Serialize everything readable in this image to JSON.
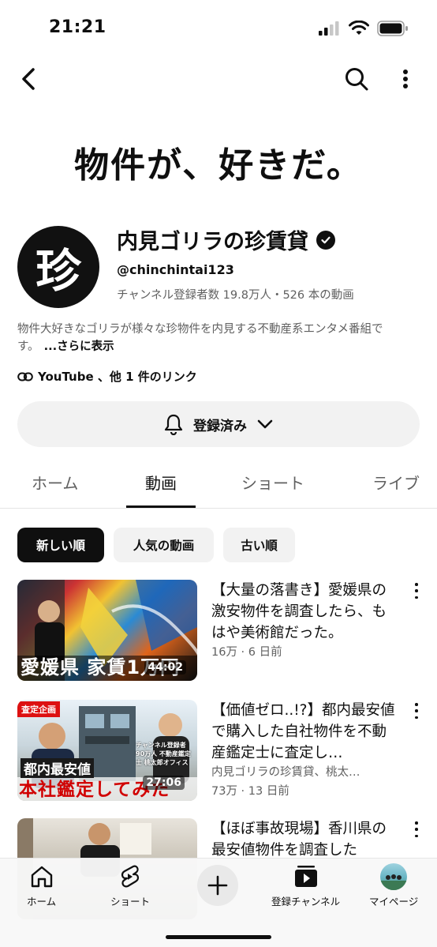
{
  "status_bar": {
    "time": "21:21"
  },
  "channel": {
    "banner_text": "物件が、好きだ。",
    "avatar_char": "珍",
    "name": "内見ゴリラの珍賃貸",
    "handle": "@chinchintai123",
    "stats": "チャンネル登録者数 19.8万人・526 本の動画",
    "description": "物件大好きなゴリラが様々な珍物件を内見する不動産系エンタメ番組です。",
    "description_more": "...さらに表示",
    "links": "YouTube 、他 1 件のリンク",
    "subscribe_label": "登録済み"
  },
  "tabs": [
    {
      "label": "ホーム",
      "active": false
    },
    {
      "label": "動画",
      "active": true
    },
    {
      "label": "ショート",
      "active": false
    },
    {
      "label": "ライブ",
      "active": false
    }
  ],
  "sort_chips": [
    {
      "label": "新しい順",
      "active": true
    },
    {
      "label": "人気の動画",
      "active": false
    },
    {
      "label": "古い順",
      "active": false
    }
  ],
  "videos": [
    {
      "title": "【大量の落書き】愛媛県の激安物件を調査したら、もはや美術館だった。",
      "meta": "16万 · 6 日前",
      "duration": "44:02",
      "thumb_caption": "愛媛県 家賃1万円"
    },
    {
      "title": "【価値ゼロ..!?】都内最安値で購入した自社物件を不動産鑑定士に査定し…",
      "channel": "内見ゴリラの珍賃貸、桃太…",
      "meta": "73万 · 13 日前",
      "duration": "27:06",
      "thumb_tag": "査定企画",
      "thumb_caption_top": "都内最安値",
      "thumb_caption": "本社鑑定してみた",
      "thumb_side": "チャンネル登録者90万人 不動産鑑定士 桃太郎オフィス"
    },
    {
      "title": "【ほぼ事故現場】香川県の最安値物件を調査した",
      "meta": ""
    }
  ],
  "bottom_nav": [
    {
      "label": "ホーム",
      "icon": "home-icon"
    },
    {
      "label": "ショート",
      "icon": "shorts-icon"
    },
    {
      "label": "",
      "icon": "create-icon"
    },
    {
      "label": "登録チャンネル",
      "icon": "subscriptions-icon"
    },
    {
      "label": "マイページ",
      "icon": "profile-avatar"
    }
  ],
  "colors": {
    "text": "#0f0f0f",
    "secondary": "#606060",
    "chip_bg": "#f2f2f2"
  }
}
